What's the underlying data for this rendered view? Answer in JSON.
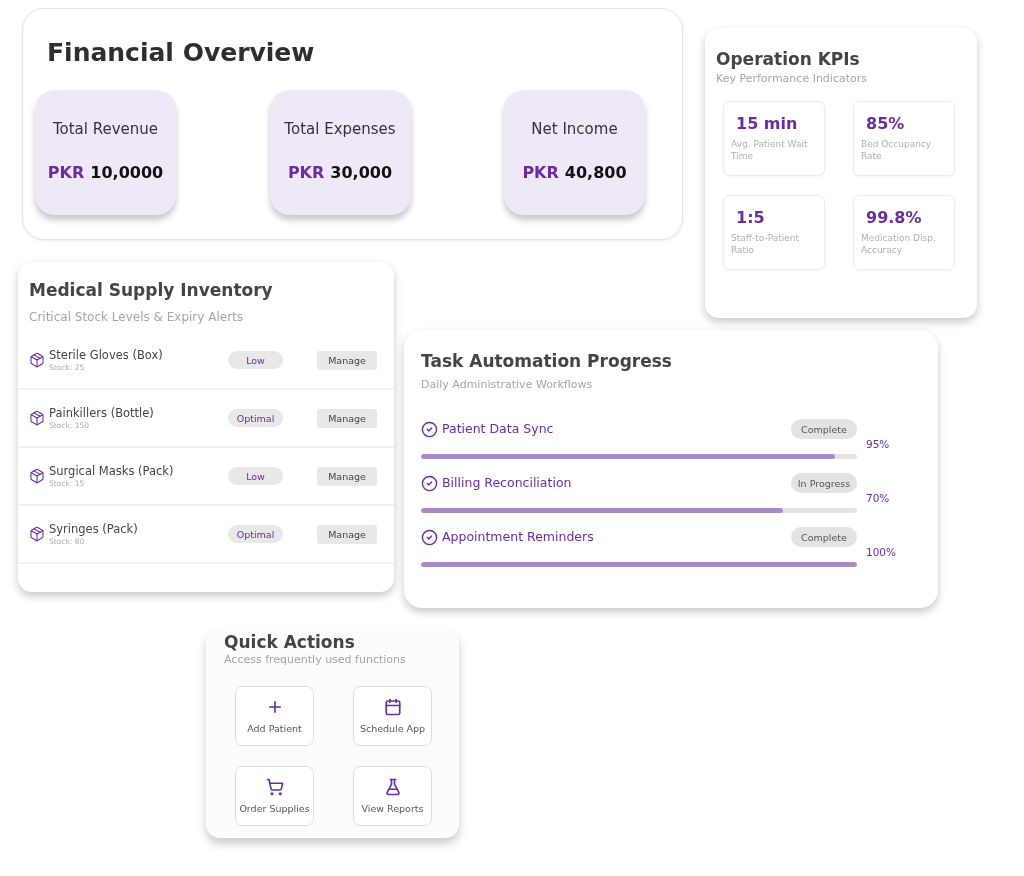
{
  "financial_overview": {
    "title": "Financial Overview",
    "tiles": [
      {
        "label": "Total Revenue",
        "currency": "PKR",
        "amount": "10,0000"
      },
      {
        "label": "Total Expenses",
        "currency": "PKR",
        "amount": "30,000"
      },
      {
        "label": "Net Income",
        "currency": "PKR",
        "amount": "40,800"
      }
    ]
  },
  "operation_kpis": {
    "title": "Operation KPIs",
    "subtitle": "Key Performance Indicators",
    "kpis": [
      {
        "value": "15 min",
        "label": "Avg. Patient Wait Time"
      },
      {
        "value": "85%",
        "label": "Bed Occupancy Rate"
      },
      {
        "value": "1:5",
        "label": "Staff-to-Patient Ratio"
      },
      {
        "value": "99.8%",
        "label": "Medication Disp. Accuracy"
      }
    ]
  },
  "inventory": {
    "title": "Medical Supply Inventory",
    "subtitle": "Critical Stock Levels & Expiry Alerts",
    "items": [
      {
        "name": "Sterile Gloves (Box)",
        "stock": "Stock: 25",
        "status": "Low",
        "action": "Manage"
      },
      {
        "name": "Painkillers (Bottle)",
        "stock": "Stock: 150",
        "status": "Optimal",
        "action": "Manage"
      },
      {
        "name": "Surgical Masks (Pack)",
        "stock": "Stock: 15",
        "status": "Low",
        "action": "Manage"
      },
      {
        "name": "Syringes (Pack)",
        "stock": "Stock: 80",
        "status": "Optimal",
        "action": "Manage"
      }
    ]
  },
  "task_automation": {
    "title": "Task Automation Progress",
    "subtitle": "Daily Administrative Workflows",
    "tasks": [
      {
        "name": "Patient Data Sync",
        "status": "Complete",
        "level": 0.95,
        "reading": "95%"
      },
      {
        "name": "Billing Reconciliation",
        "status": "In Progress",
        "level": 0.83,
        "reading": "70%"
      },
      {
        "name": "Appointment Reminders",
        "status": "Complete",
        "level": 1,
        "reading": "100%"
      }
    ]
  },
  "quick_actions": {
    "title": "Quick Actions",
    "subtitle": "Access frequently used functions",
    "actions": [
      {
        "kind": "add",
        "label": "Add Patient"
      },
      {
        "kind": "schedule",
        "label": "Schedule App"
      },
      {
        "kind": "order",
        "label": "Order Supplies"
      },
      {
        "kind": "report",
        "label": "View Reports"
      }
    ]
  }
}
